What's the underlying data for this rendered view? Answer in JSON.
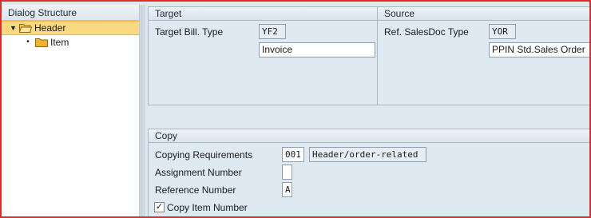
{
  "dialog_structure": {
    "title": "Dialog Structure",
    "items": [
      {
        "label": "Header",
        "expanded": true,
        "selected": true
      },
      {
        "label": "Item",
        "expanded": false,
        "selected": false
      }
    ]
  },
  "target": {
    "title": "Target",
    "bill_type_label": "Target Bill. Type",
    "bill_type_value": "YF2",
    "bill_type_desc": "Invoice"
  },
  "source": {
    "title": "Source",
    "salesdoc_label": "Ref. SalesDoc Type",
    "salesdoc_value": "YOR",
    "salesdoc_desc": "PPIN Std.Sales Order"
  },
  "copy": {
    "title": "Copy",
    "copying_req_label": "Copying Requirements",
    "copying_req_value": "001",
    "copying_req_desc": "Header/order-related",
    "assignment_label": "Assignment Number",
    "assignment_value": "",
    "reference_label": "Reference Number",
    "reference_value": "A",
    "copy_item_label": "Copy Item Number",
    "copy_item_checked": true,
    "check_mark": "✓"
  },
  "colors": {
    "frame": "#d9302c",
    "selection": "#fbd882",
    "panel_bg": "#dfe9f2",
    "folder": "#f0b429"
  }
}
